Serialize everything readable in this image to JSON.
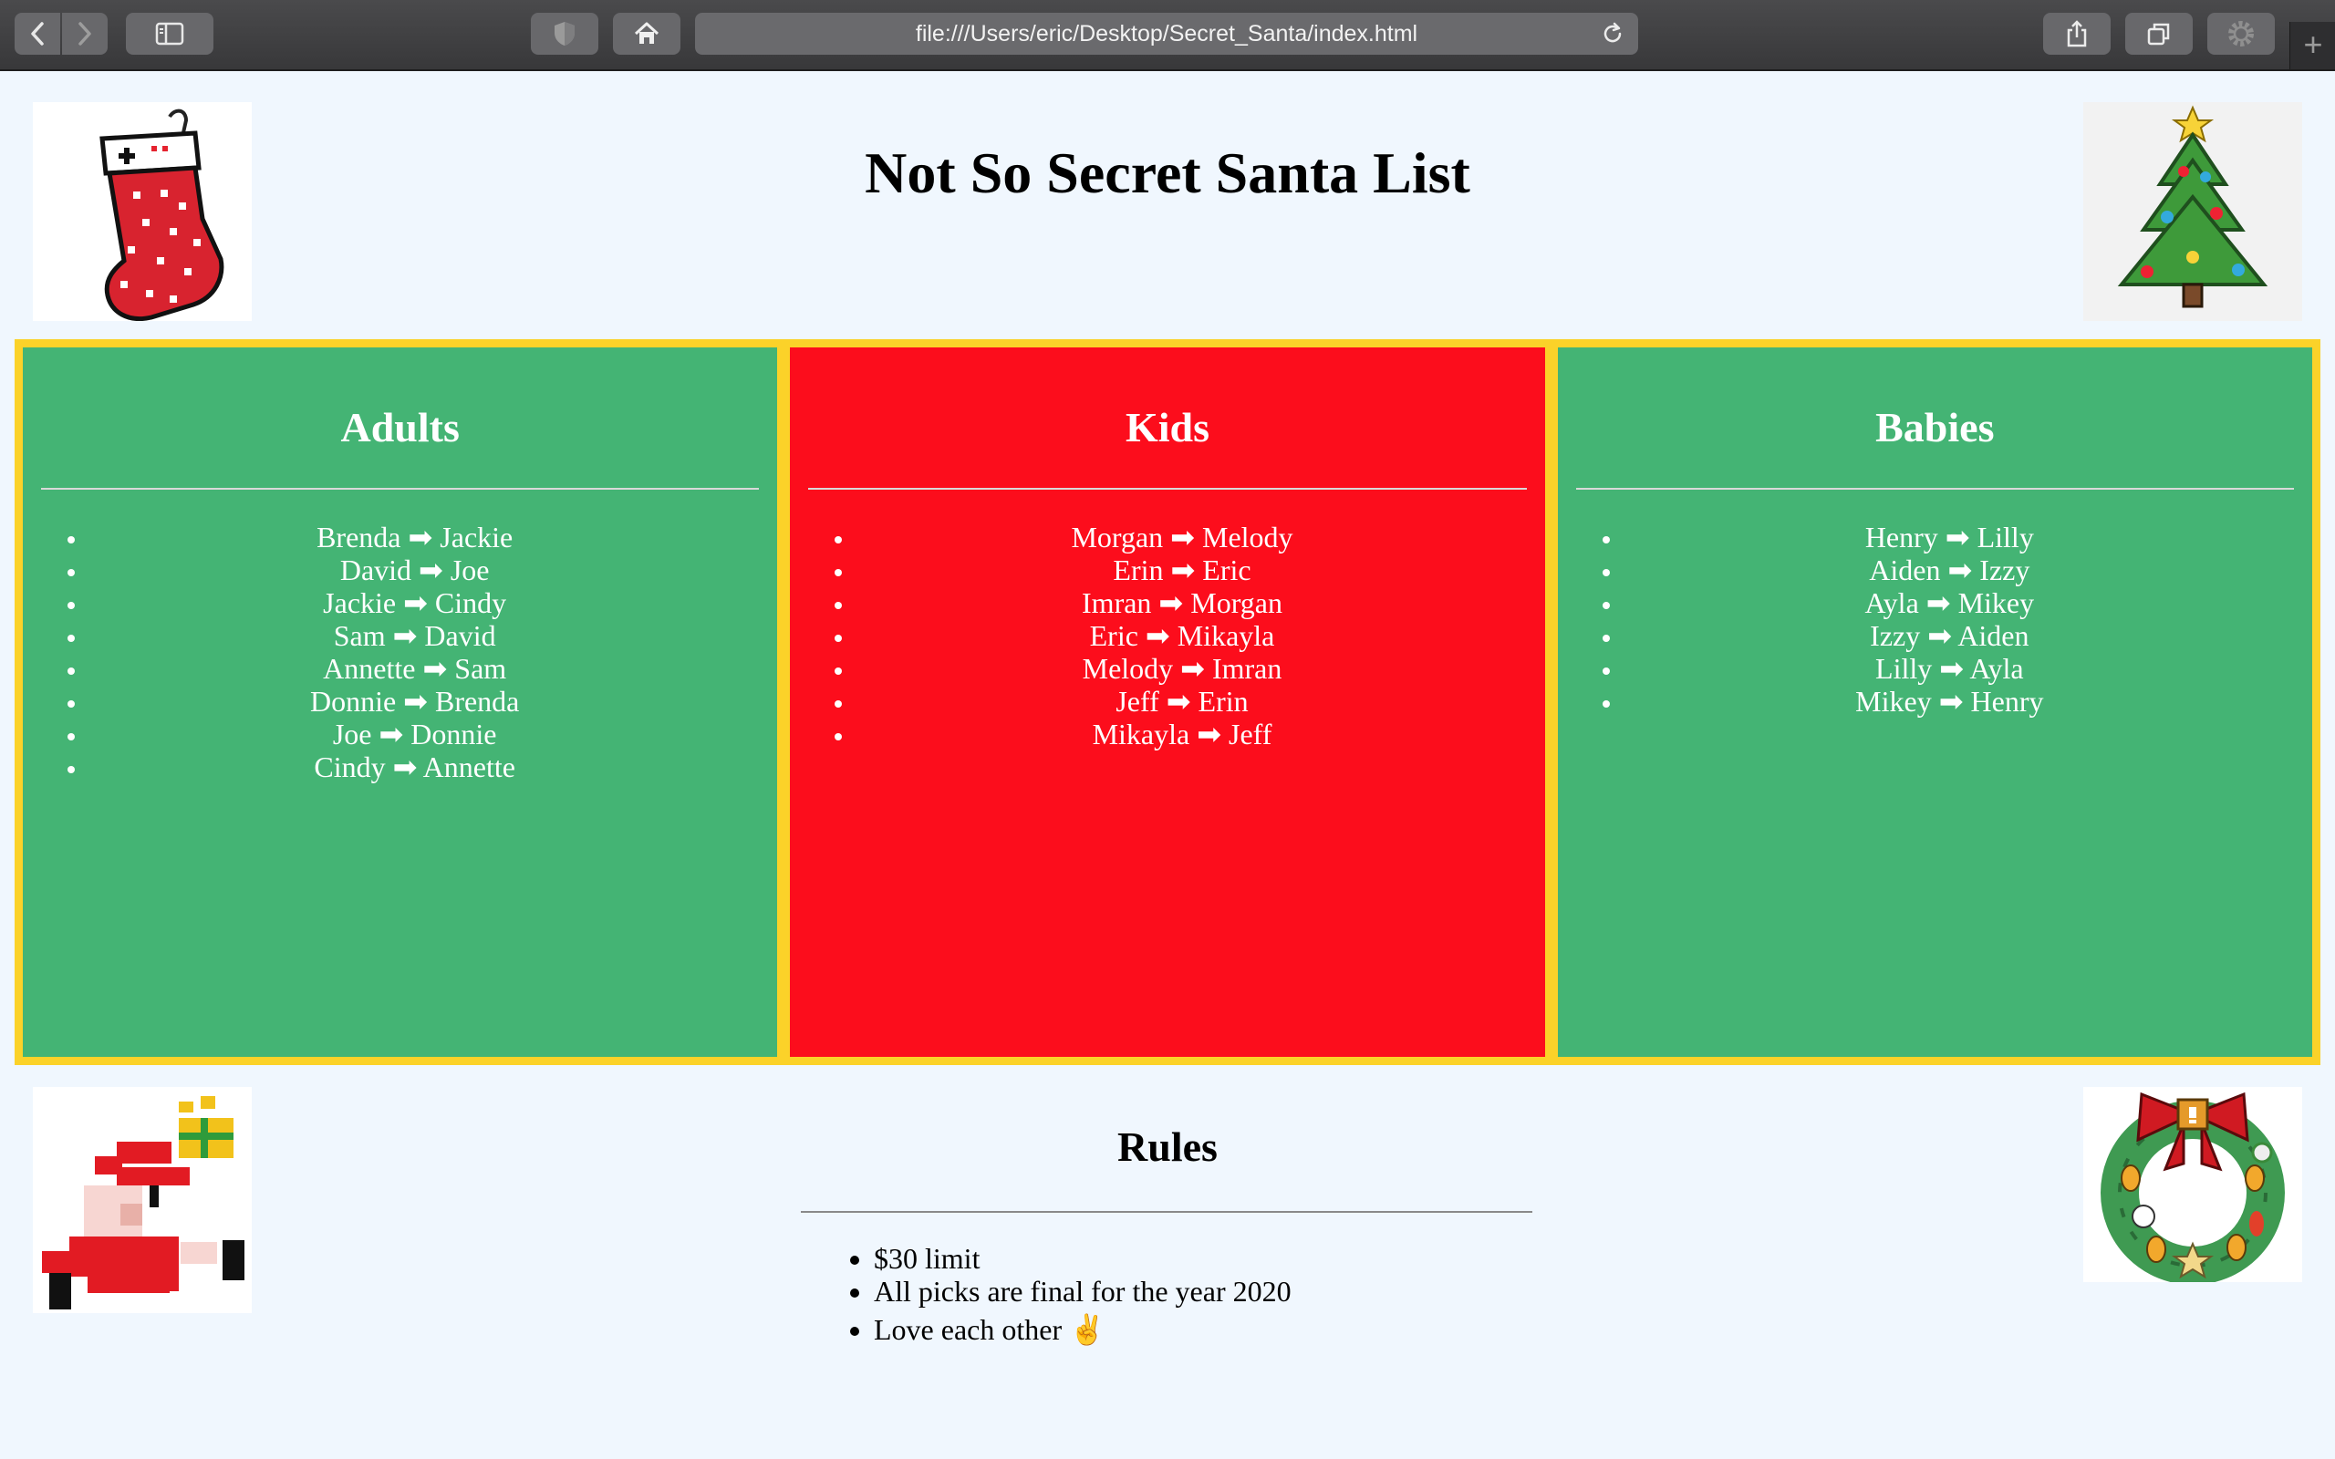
{
  "browser": {
    "url": "file:///Users/eric/Desktop/Secret_Santa/index.html"
  },
  "page": {
    "title": "Not So Secret Santa List"
  },
  "columns": [
    {
      "heading": "Adults",
      "color": "#44b474",
      "pairs": [
        "Brenda ➡ Jackie",
        "David ➡ Joe",
        "Jackie ➡ Cindy",
        "Sam ➡ David",
        "Annette ➡ Sam",
        "Donnie ➡ Brenda",
        "Joe ➡ Donnie",
        "Cindy ➡ Annette"
      ]
    },
    {
      "heading": "Kids",
      "color": "#fc0d1c",
      "pairs": [
        "Morgan ➡ Melody",
        "Erin ➡ Eric",
        "Imran ➡ Morgan",
        "Eric ➡ Mikayla",
        "Melody ➡ Imran",
        "Jeff ➡ Erin",
        "Mikayla ➡ Jeff"
      ]
    },
    {
      "heading": "Babies",
      "color": "#44b474",
      "pairs": [
        "Henry ➡ Lilly",
        "Aiden ➡ Izzy",
        "Ayla ➡ Mikey",
        "Izzy ➡ Aiden",
        "Lilly ➡ Ayla",
        "Mikey ➡ Henry"
      ]
    }
  ],
  "rules": {
    "heading": "Rules",
    "items": [
      "$30 limit",
      "All picks are final for the year 2020",
      "Love each other ✌"
    ]
  },
  "colors": {
    "page_bg": "#f0f7fe",
    "panel_border": "#fbd229",
    "green": "#44b474",
    "red": "#fc0d1c"
  },
  "icons": {
    "images": [
      "stocking-icon",
      "christmas-tree-icon",
      "santa-icon",
      "wreath-icon"
    ]
  }
}
